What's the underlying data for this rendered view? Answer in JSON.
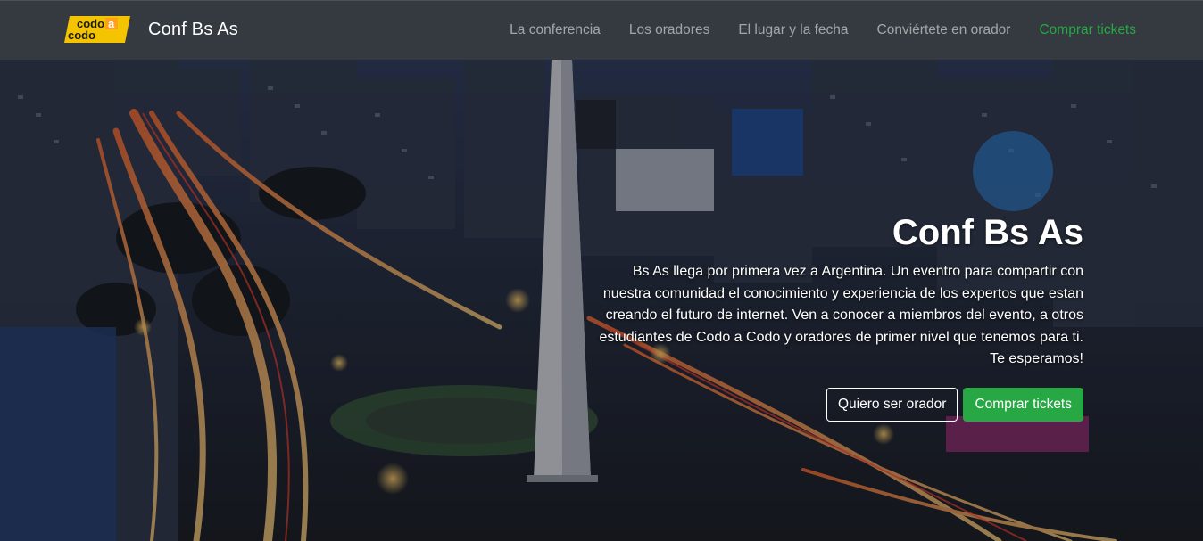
{
  "brand": {
    "logo_line1": "codo",
    "logo_a": "a",
    "logo_line2": "codo",
    "title": "Conf Bs As"
  },
  "nav": {
    "items": [
      {
        "label": "La conferencia"
      },
      {
        "label": "Los oradores"
      },
      {
        "label": "El lugar y la fecha"
      },
      {
        "label": "Conviértete en orador"
      },
      {
        "label": "Comprar tickets"
      }
    ]
  },
  "hero": {
    "title": "Conf Bs As",
    "text": "Bs As llega por primera vez a Argentina. Un eventro para compartir con nuestra comunidad el conocimiento y experiencia de los expertos que estan creando el futuro de internet. Ven a conocer a miembros del evento, a otros estudiantes de Codo a Codo y oradores de primer nivel que tenemos para ti. Te esperamos!",
    "button_speaker": "Quiero ser orador",
    "button_tickets": "Comprar tickets"
  },
  "colors": {
    "navbar_bg": "#343a40",
    "accent_green": "#28a745",
    "logo_yellow": "#f5c400"
  }
}
